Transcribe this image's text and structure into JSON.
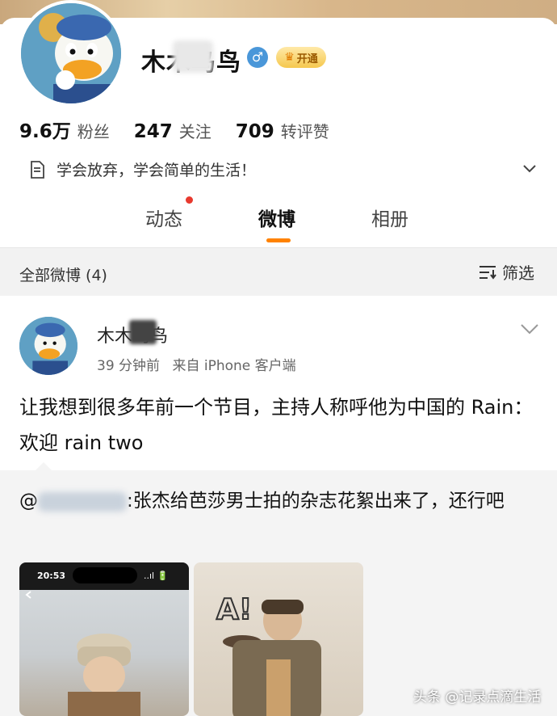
{
  "profile": {
    "name": "木木鸟鸟",
    "gender_symbol": "♂",
    "vip_label": "开通",
    "stats": [
      {
        "num": "9.6万",
        "label": "粉丝"
      },
      {
        "num": "247",
        "label": "关注"
      },
      {
        "num": "709",
        "label": "转评赞"
      }
    ],
    "bio": "学会放弃，学会简单的生活！"
  },
  "tabs": [
    {
      "label": "动态",
      "active": false
    },
    {
      "label": "微博",
      "active": true
    },
    {
      "label": "相册",
      "active": false
    }
  ],
  "filter": {
    "title": "全部微博 (4)",
    "button_label": "筛选"
  },
  "post": {
    "author": "木木鸟鸟",
    "time": "39 分钟前",
    "source": "来自 iPhone 客户端",
    "text": "让我想到很多年前一个节目，主持人称呼他为中国的 Rain：欢迎 rain two",
    "repost_prefix": "@",
    "repost_text": ":张杰给芭莎男士拍的杂志花絮出来了，还行吧",
    "thumb1_status": {
      "time": "20:53",
      "signal": "..ıl 🔋"
    },
    "thumb2_caption": "A!"
  },
  "watermark": "头条 @记录点滴生活",
  "colors": {
    "accent": "#ff8200",
    "dot": "#e8392e",
    "gender": "#4a97d9"
  }
}
